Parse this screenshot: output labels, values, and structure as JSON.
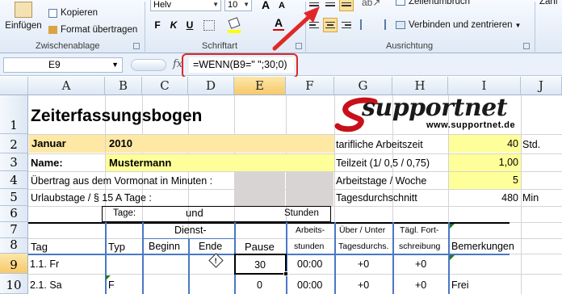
{
  "ribbon": {
    "paste_label": "Einfügen",
    "kopieren_label": "Kopieren",
    "format_label": "Format übertragen",
    "clipboard_group": "Zwischenablage",
    "font_name": "Helv",
    "font_size": "10",
    "font_group": "Schriftart",
    "bold": "F",
    "italic": "K",
    "underline": "U",
    "grow_font": "A",
    "shrink_font": "A",
    "font_color_letter": "A",
    "wrap_label": "Zeilenumbruch",
    "merge_label": "Verbinden und zentrieren",
    "align_group": "Ausrichtung",
    "number_group_partial": "Zahl"
  },
  "formula_bar": {
    "cell_ref": "E9",
    "formula": "=WENN(B9=\" \";30;0)"
  },
  "columns": [
    "A",
    "B",
    "C",
    "D",
    "E",
    "F",
    "G",
    "H",
    "I",
    "J"
  ],
  "rows": [
    "1",
    "2",
    "3",
    "4",
    "5",
    "6",
    "7",
    "8",
    "9",
    "10"
  ],
  "sheet": {
    "title": "Zeiterfassungsbogen",
    "logo_text": "supportnet",
    "logo_url": "www.supportnet.de",
    "month": "Januar",
    "year": "2010",
    "name_label": "Name:",
    "name_value": "Mustermann",
    "uebertrag_label": "Übertrag aus dem Vormonat in Minuten :",
    "urlaub_label": "Urlaubstage / § 15 A Tage :",
    "tarif_label": "tarifliche Arbeitszeit",
    "tarif_value": "40",
    "tarif_unit": "Std.",
    "teilzeit_label": "Teilzeit (1/ 0,5 / 0,75)",
    "teilzeit_value": "1,00",
    "arbeitstage_label": "Arbeitstage / Woche",
    "arbeitstage_value": "5",
    "tagesdurch_label": "Tagesdurchschnitt",
    "tagesdurch_value": "480",
    "tagesdurch_unit": "Min",
    "row6_tage": "Tage:",
    "row6_und": "und",
    "row6_stunden": "Stunden",
    "hdr_tag": "Tag",
    "hdr_typ": "Typ",
    "hdr_dienst": "Dienst-",
    "hdr_beginn": "Beginn",
    "hdr_ende": "Ende",
    "hdr_pause": "Pause",
    "hdr_arbeits1": "Arbeits-",
    "hdr_arbeits2": "stunden",
    "hdr_ueber1": "Über / Unter",
    "hdr_ueber2": "Tagesdurchs.",
    "hdr_taegl1": "Tägl. Fort-",
    "hdr_taegl2": "schreibung",
    "hdr_bemerk": "Bemerkungen"
  },
  "data_rows": [
    {
      "tag": "1.1. Fr",
      "typ": "",
      "pause": "30",
      "arbeitsstunden": "00:00",
      "ueber_unter": "+0",
      "fortschreibung": "+0",
      "bemerkung": ""
    },
    {
      "tag": "2.1. Sa",
      "typ": "F",
      "pause": "0",
      "arbeitsstunden": "00:00",
      "ueber_unter": "+0",
      "fortschreibung": "+0",
      "bemerkung": "Frei"
    }
  ],
  "colors": {
    "highlight_ring": "#e02828",
    "yellow_input": "#ffff99",
    "tan_input": "#ffe8a4",
    "selected_header": "#f7c96b"
  }
}
